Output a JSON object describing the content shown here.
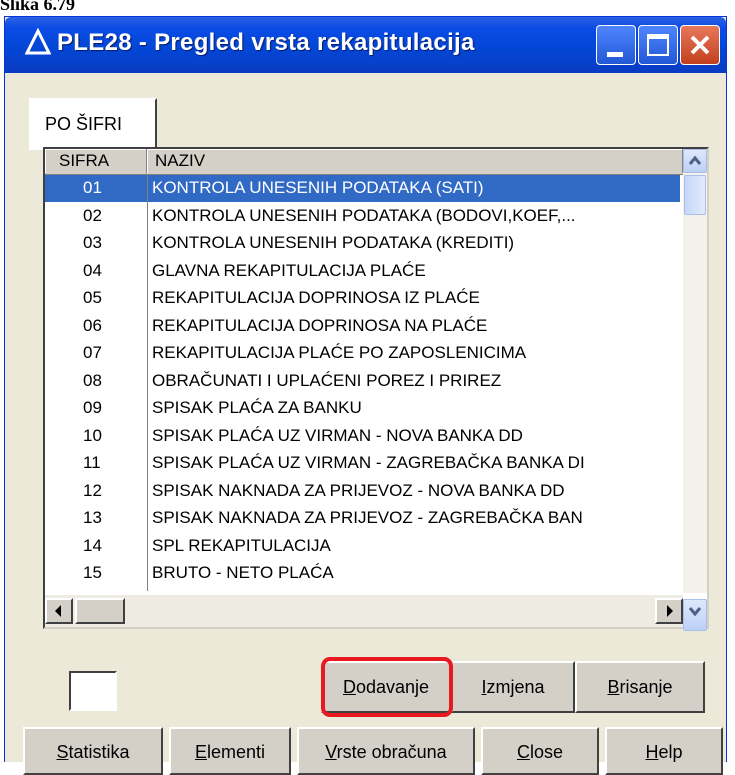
{
  "caption": "Slika 6.79",
  "window": {
    "title": "PLE28 - Pregled vrsta rekapitulacija"
  },
  "tab": {
    "label": "PO ŠIFRI"
  },
  "grid": {
    "columns": [
      "SIFRA",
      "NAZIV"
    ],
    "rows": [
      {
        "code": "01",
        "name": "KONTROLA UNESENIH PODATAKA (SATI)",
        "selected": true
      },
      {
        "code": "02",
        "name": "KONTROLA UNESENIH PODATAKA (BODOVI,KOEF,..."
      },
      {
        "code": "03",
        "name": "KONTROLA UNESENIH PODATAKA (KREDITI)"
      },
      {
        "code": "04",
        "name": "GLAVNA REKAPITULACIJA PLAĆE"
      },
      {
        "code": "05",
        "name": "REKAPITULACIJA DOPRINOSA IZ PLAĆE"
      },
      {
        "code": "06",
        "name": "REKAPITULACIJA DOPRINOSA NA PLAĆE"
      },
      {
        "code": "07",
        "name": "REKAPITULACIJA PLAĆE PO ZAPOSLENICIMA"
      },
      {
        "code": "08",
        "name": "OBRAČUNATI I UPLAĆENI POREZ I PRIREZ"
      },
      {
        "code": "09",
        "name": "SPISAK PLAĆA ZA BANKU"
      },
      {
        "code": "10",
        "name": "SPISAK PLAĆA UZ VIRMAN - NOVA  BANKA DD"
      },
      {
        "code": "11",
        "name": "SPISAK PLAĆA UZ VIRMAN - ZAGREBAČKA BANKA DI"
      },
      {
        "code": "12",
        "name": "SPISAK NAKNADA ZA PRIJEVOZ - NOVA BANKA DD"
      },
      {
        "code": "13",
        "name": "SPISAK NAKNADA ZA PRIJEVOZ - ZAGREBAČKA BAN"
      },
      {
        "code": "14",
        "name": "SPL REKAPITULACIJA"
      },
      {
        "code": "15",
        "name": "BRUTO - NETO PLAĆA"
      }
    ]
  },
  "actions": {
    "add": {
      "u": "D",
      "rest": "odavanje"
    },
    "edit": {
      "u": "I",
      "rest": "zmjena"
    },
    "delete": {
      "u": "B",
      "rest": "risanje"
    }
  },
  "bottom": {
    "statistika": {
      "u": "S",
      "rest": "tatistika"
    },
    "elementi": {
      "u": "E",
      "rest": "lementi"
    },
    "vrste": {
      "u": "V",
      "rest": "rste obračuna"
    },
    "close": {
      "u": "C",
      "rest": "lose"
    },
    "help": {
      "u": "H",
      "rest": "elp"
    }
  },
  "colors": {
    "titlebar": "#0a4be6",
    "selection": "#316ac5",
    "highlight": "#e8191f"
  }
}
